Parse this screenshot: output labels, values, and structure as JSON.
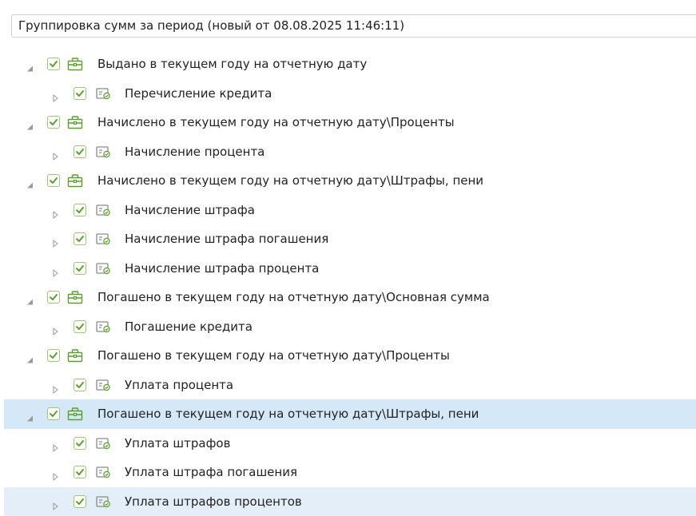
{
  "header": {
    "title": "Группировка сумм за период (новый от 08.08.2025 11:46:11)"
  },
  "colors": {
    "selected_row": "#d4e8f7",
    "hover_row": "#e3eef8",
    "check_green": "#5a9e2e",
    "group_icon_green": "#5a9e2e"
  },
  "tree": {
    "rows": [
      {
        "level": 0,
        "expanded": true,
        "checked": true,
        "icon": "group-folder-icon",
        "label": "Выдано в текущем году на отчетную дату"
      },
      {
        "level": 1,
        "expanded": false,
        "checked": true,
        "icon": "operation-icon",
        "label": "Перечисление кредита"
      },
      {
        "level": 0,
        "expanded": true,
        "checked": true,
        "icon": "group-folder-icon",
        "label": "Начислено в текущем году на отчетную дату\\Проценты"
      },
      {
        "level": 1,
        "expanded": false,
        "checked": true,
        "icon": "operation-icon",
        "label": "Начисление процента"
      },
      {
        "level": 0,
        "expanded": true,
        "checked": true,
        "icon": "group-folder-icon",
        "label": "Начислено в текущем году на отчетную дату\\Штрафы, пени"
      },
      {
        "level": 1,
        "expanded": false,
        "checked": true,
        "icon": "operation-icon",
        "label": "Начисление штрафа"
      },
      {
        "level": 1,
        "expanded": false,
        "checked": true,
        "icon": "operation-icon",
        "label": "Начисление штрафа погашения"
      },
      {
        "level": 1,
        "expanded": false,
        "checked": true,
        "icon": "operation-icon",
        "label": "Начисление штрафа процента"
      },
      {
        "level": 0,
        "expanded": true,
        "checked": true,
        "icon": "group-folder-icon",
        "label": "Погашено в текущем году на отчетную дату\\Основная сумма"
      },
      {
        "level": 1,
        "expanded": false,
        "checked": true,
        "icon": "operation-icon",
        "label": "Погашение кредита"
      },
      {
        "level": 0,
        "expanded": true,
        "checked": true,
        "icon": "group-folder-icon",
        "label": "Погашено в текущем году на отчетную дату\\Проценты"
      },
      {
        "level": 1,
        "expanded": false,
        "checked": true,
        "icon": "operation-icon",
        "label": "Уплата процента"
      },
      {
        "level": 0,
        "expanded": true,
        "checked": true,
        "icon": "group-folder-icon",
        "label": "Погашено в текущем году на отчетную дату\\Штрафы, пени",
        "state": "selected"
      },
      {
        "level": 1,
        "expanded": false,
        "checked": true,
        "icon": "operation-icon",
        "label": "Уплата штрафов"
      },
      {
        "level": 1,
        "expanded": false,
        "checked": true,
        "icon": "operation-icon",
        "label": "Уплата штрафа погашения"
      },
      {
        "level": 1,
        "expanded": false,
        "checked": true,
        "icon": "operation-icon",
        "label": "Уплата штрафов процентов",
        "state": "hover"
      }
    ]
  }
}
